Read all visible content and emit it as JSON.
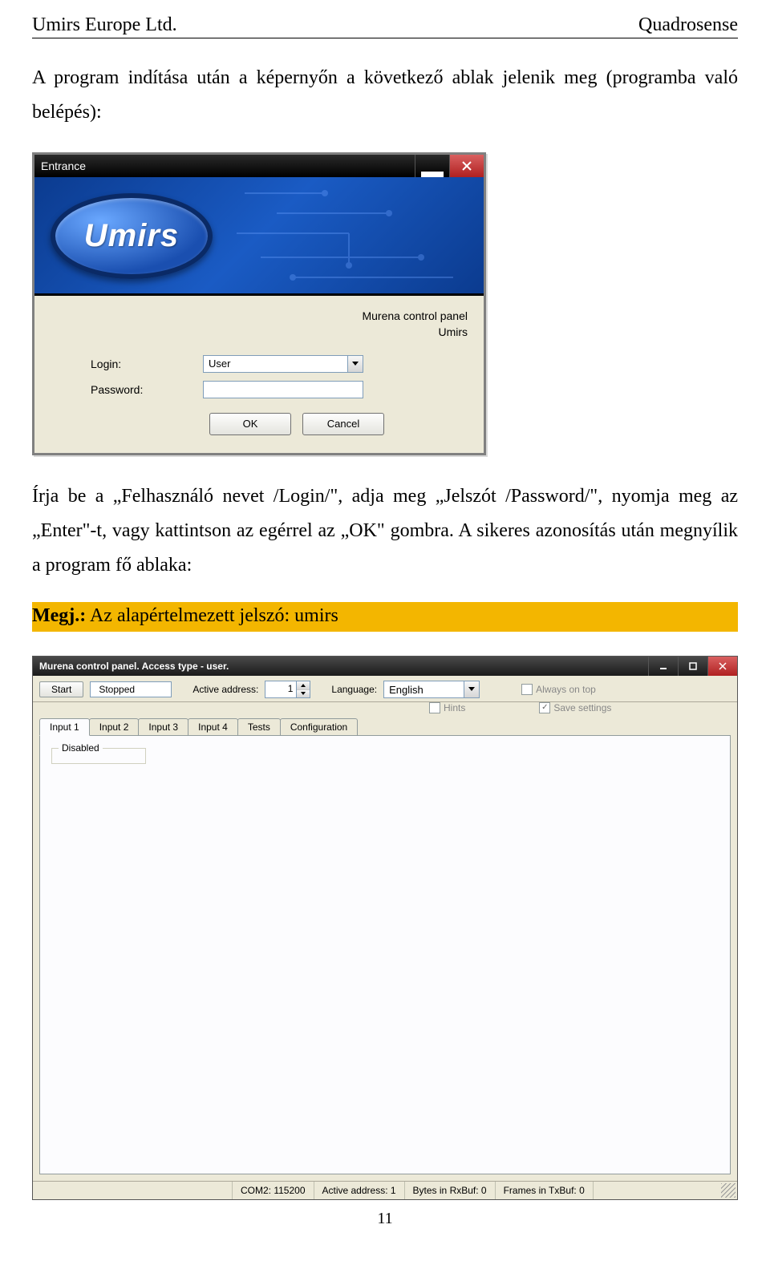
{
  "header": {
    "left": "Umirs Europe Ltd.",
    "right": "Quadrosense"
  },
  "intro": "A program indítása után a képernyőn a következő ablak jelenik meg (programba való belépés):",
  "entrance": {
    "window_title": "Entrance",
    "logo_text": "Umirs",
    "app_line1": "Murena control panel",
    "app_line2": "Umirs",
    "login_label": "Login:",
    "login_value": "User",
    "password_label": "Password:",
    "ok": "OK",
    "cancel": "Cancel"
  },
  "para2": "Írja be a „Felhasználó nevet /Login/\", adja meg „Jelszót /Password/\", nyomja meg az „Enter\"-t, vagy kattintson az egérrel az „OK\" gombra. A sikeres azonosítás után megnyílik a program fő ablaka:",
  "note_bold": "Megj.:",
  "note_rest": " Az alapértelmezett jelszó: umirs",
  "main": {
    "window_title": "Murena control panel. Access type - user.",
    "start_btn": "Start",
    "stopped": "Stopped",
    "active_address_label": "Active address:",
    "active_address_value": "1",
    "language_label": "Language:",
    "language_value": "English",
    "always_on_top": "Always on top",
    "hints": "Hints",
    "save_settings": "Save settings",
    "tabs": [
      "Input 1",
      "Input 2",
      "Input 3",
      "Input 4",
      "Tests",
      "Configuration"
    ],
    "disabled": "Disabled",
    "status": {
      "com": "COM2: 115200",
      "addr": "Active address:  1",
      "rx": "Bytes in RxBuf: 0",
      "tx": "Frames in TxBuf: 0"
    }
  },
  "page_num": "11"
}
